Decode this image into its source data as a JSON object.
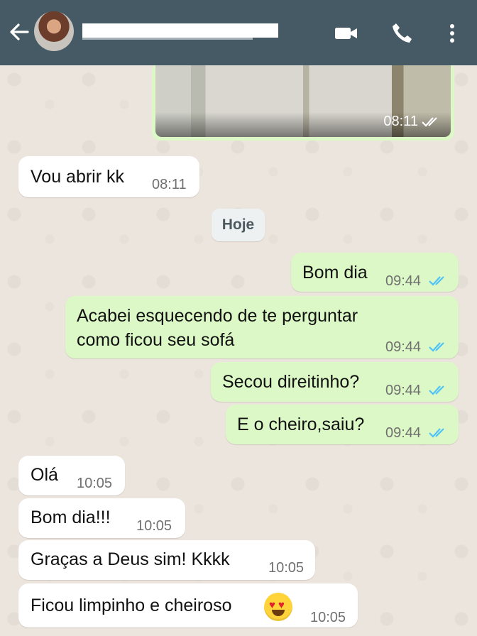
{
  "header": {
    "back_icon": "arrow-back-icon",
    "video_icon": "video-camera-icon",
    "call_icon": "phone-icon",
    "menu_icon": "more-vertical-icon",
    "contact_name": ""
  },
  "chat": {
    "image_message": {
      "time": "08:11",
      "status": "read"
    },
    "messages": [
      {
        "text": "Vou abrir kk",
        "time": "08:11",
        "direction": "incoming"
      },
      {
        "text": "Hoje",
        "type": "date"
      },
      {
        "text": "Bom dia",
        "time": "09:44",
        "direction": "outgoing"
      },
      {
        "text": "Acabei esquecendo de te perguntar\ncomo ficou seu sofá",
        "time": "09:44",
        "direction": "outgoing"
      },
      {
        "text": "Secou direitinho?",
        "time": "09:44",
        "direction": "outgoing"
      },
      {
        "text": "E o cheiro,saiu?",
        "time": "09:44",
        "direction": "outgoing"
      },
      {
        "text": "Olá",
        "time": "10:05",
        "direction": "incoming"
      },
      {
        "text": "Bom dia!!!",
        "time": "10:05",
        "direction": "incoming"
      },
      {
        "text": "Graças a Deus sim! Kkkk",
        "time": "10:05",
        "direction": "incoming"
      },
      {
        "text": "Ficou limpinho e cheiroso",
        "time": "10:05",
        "direction": "incoming",
        "emoji": "heart-eyes-emoji"
      }
    ]
  },
  "colors": {
    "header": "#455a64",
    "incoming": "#ffffff",
    "outgoing": "#dcf8c6",
    "background": "#ece5dd",
    "read_check": "#4fc3f7"
  }
}
